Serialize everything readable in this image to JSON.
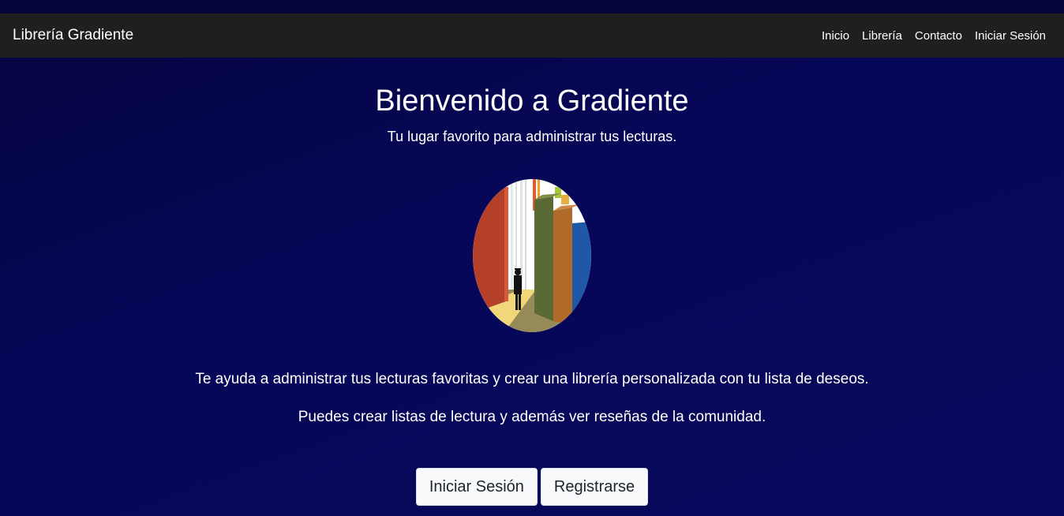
{
  "navbar": {
    "brand": "Librería Gradiente",
    "links": [
      "Inicio",
      "Librería",
      "Contacto",
      "Iniciar Sesión"
    ]
  },
  "hero": {
    "title": "Bienvenido a Gradiente",
    "subtitle": "Tu lugar favorito para administrar tus lecturas.",
    "description_1": "Te ayuda a administrar tus lecturas favoritas y crear una librería personalizada con tu lista de deseos.",
    "description_2": "Puedes crear listas de lectura y además ver reseñas de la comunidad.",
    "login_button": "Iniciar Sesión",
    "register_button": "Registrarse"
  },
  "colors": {
    "background": "#06064e",
    "navbar": "#1f1f1f",
    "button": "#f8f9fa"
  },
  "image": {
    "semantic": "books-illustration"
  }
}
